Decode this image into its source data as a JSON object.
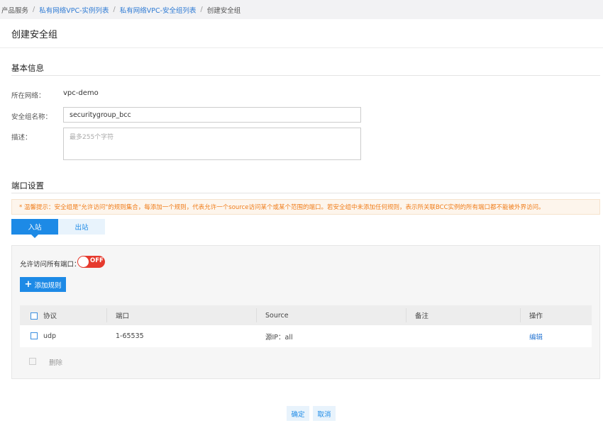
{
  "breadcrumb": {
    "items": [
      "产品服务",
      "私有网络VPC-实例列表",
      "私有网络VPC-安全组列表",
      "创建安全组"
    ],
    "separator": "/"
  },
  "page": {
    "title": "创建安全组"
  },
  "basic_info": {
    "title": "基本信息",
    "network_label": "所在网络：",
    "network_value": "vpc-demo",
    "name_label": "安全组名称：",
    "name_value": "securitygroup_bcc",
    "desc_label": "描述：",
    "desc_placeholder": "最多255个字符"
  },
  "port_settings": {
    "title": "端口设置",
    "warning": "* 温馨提示：安全组是\"允许访问\"的规则集合，每添加一个规则，代表允许一个source访问某个或某个范围的端口。若安全组中未添加任何规则，表示所关联BCC实例的所有端口都不能被外界访问。",
    "tabs": [
      {
        "label": "入站",
        "active": true
      },
      {
        "label": "出站",
        "active": false
      }
    ],
    "allow_all_label": "允许访问所有端口：",
    "toggle_text": "OFF",
    "add_rule_label": "添加规则",
    "columns": [
      "协议",
      "端口",
      "Source",
      "备注",
      "操作"
    ],
    "rows": [
      {
        "protocol": "udp",
        "port": "1-65535",
        "source": "源IP：all",
        "remark": "",
        "action": "编辑"
      }
    ],
    "delete_label": "删除"
  },
  "footer": {
    "confirm_label": "确定",
    "cancel_label": "取消"
  },
  "colors": {
    "primary": "#1d8ae6",
    "toggle_off": "#e63a2e",
    "warning_text": "#f07d1a"
  }
}
